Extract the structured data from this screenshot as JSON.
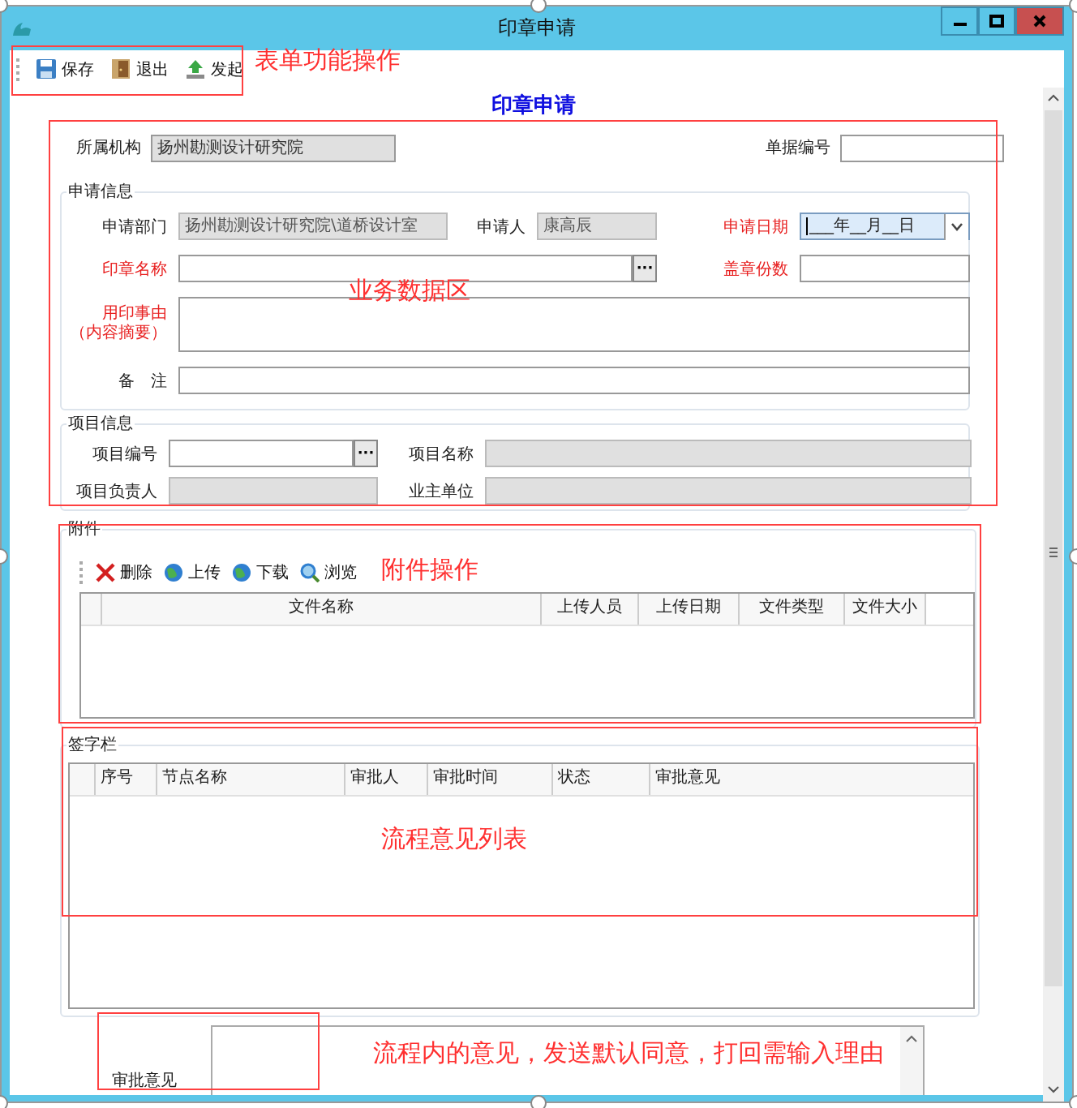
{
  "window": {
    "title": "印章申请"
  },
  "toolbar": [
    {
      "label": "保存"
    },
    {
      "label": "退出"
    },
    {
      "label": "发起"
    }
  ],
  "form_title": "印章申请",
  "org": {
    "label": "所属机构",
    "value": "扬州勘测设计研究院",
    "disabled": true
  },
  "doc_no": {
    "label": "单据编号",
    "disabled": false
  },
  "application": {
    "title": "申请信息",
    "fields": [
      {
        "label": "申请部门",
        "value": "扬州勘测设计研究院\\道桥设计室",
        "kind": "text",
        "required": false,
        "disabled": true
      },
      {
        "label": "申请人",
        "value": "康高辰",
        "kind": "text",
        "required": false,
        "disabled": true
      },
      {
        "label": "申请日期",
        "value": "___年__月__日",
        "kind": "date",
        "required": true,
        "disabled": false,
        "focused": true
      },
      {
        "label": "印章名称",
        "kind": "picker",
        "button": "···",
        "required": true,
        "disabled": false
      },
      {
        "label": "盖章份数",
        "kind": "text",
        "required": true,
        "disabled": false
      },
      {
        "label": "用印事由",
        "note": "（内容摘要）",
        "kind": "multiline",
        "required": true,
        "disabled": false
      },
      {
        "label": "备　注",
        "kind": "text",
        "required": false,
        "disabled": false
      }
    ]
  },
  "project": {
    "title": "项目信息",
    "rows": [
      [
        {
          "label": "项目编号",
          "kind": "picker",
          "button": "···",
          "required": false,
          "disabled": false
        },
        {
          "label": "项目名称",
          "kind": "text",
          "required": false,
          "disabled": true
        }
      ],
      [
        {
          "label": "项目负责人",
          "kind": "text",
          "required": false,
          "disabled": true
        },
        {
          "label": "业主单位",
          "kind": "text",
          "required": false,
          "disabled": true
        }
      ]
    ]
  },
  "attachments": {
    "title": "附件",
    "actions": [
      {
        "label": "删除"
      },
      {
        "label": "上传"
      },
      {
        "label": "下载"
      },
      {
        "label": "浏览"
      }
    ],
    "columns": [
      "文件名称",
      "上传人员",
      "上传日期",
      "文件类型",
      "文件大小"
    ]
  },
  "signatures": {
    "title": "签字栏",
    "columns": [
      "序号",
      "节点名称",
      "审批人",
      "审批时间",
      "状态",
      "审批意见"
    ]
  },
  "opinion": {
    "label": "审批意见"
  },
  "annotations": [
    {
      "text": "表单功能操作"
    },
    {
      "text": "业务数据区"
    },
    {
      "text": "附件操作"
    },
    {
      "text": "流程意见列表"
    },
    {
      "text": "流程内的意见，发送默认同意，打回需输入理由"
    }
  ]
}
